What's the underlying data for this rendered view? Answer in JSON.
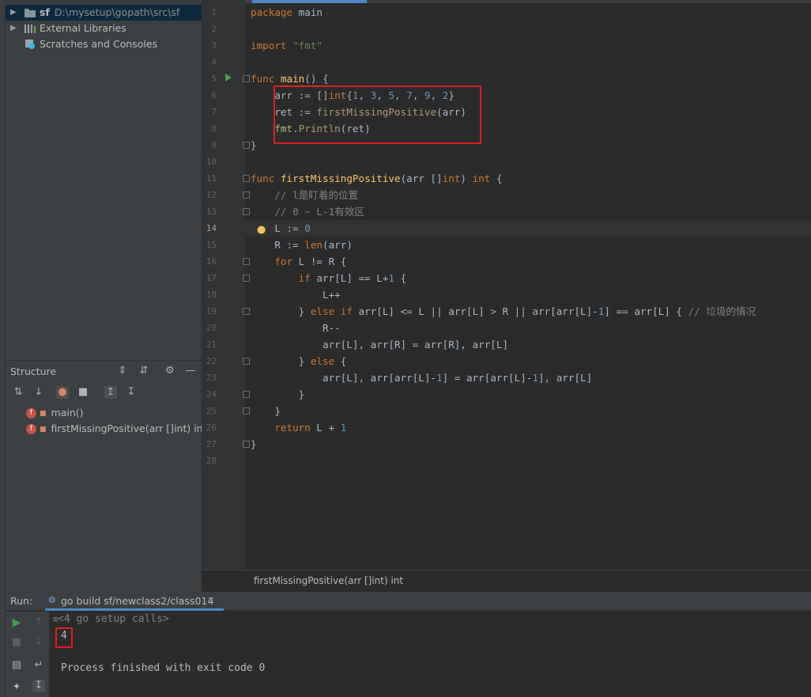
{
  "project": {
    "items": [
      {
        "name": "sf",
        "path": "D:\\mysetup\\gopath\\src\\sf",
        "icon": "folder-icon"
      },
      {
        "name": "External Libraries",
        "icon": "library-icon"
      },
      {
        "name": "Scratches and Consoles",
        "icon": "scratches-icon"
      }
    ]
  },
  "structure": {
    "title": "Structure",
    "items": [
      {
        "label": "main()"
      },
      {
        "label": "firstMissingPositive(arr []int) int"
      }
    ]
  },
  "editor": {
    "line_numbers": [
      "1",
      "2",
      "3",
      "4",
      "5",
      "6",
      "7",
      "8",
      "9",
      "10",
      "11",
      "12",
      "13",
      "14",
      "15",
      "16",
      "17",
      "18",
      "19",
      "20",
      "21",
      "22",
      "23",
      "24",
      "25",
      "26",
      "27",
      "28"
    ],
    "lines": [
      "package main",
      "",
      "import \"fmt\"",
      "",
      "func main() {",
      "    arr := []int{1, 3, 5, 7, 9, 2}",
      "    ret := firstMissingPositive(arr)",
      "    fmt.Println(ret)",
      "}",
      "",
      "func firstMissingPositive(arr []int) int {",
      "    // l是盯着的位置",
      "    // 0 ~ L-1有效区",
      "    L := 0",
      "    R := len(arr)",
      "    for L != R {",
      "        if arr[L] == L+1 {",
      "            L++",
      "        } else if arr[L] <= L || arr[L] > R || arr[arr[L]-1] == arr[L] { // 垃圾的情况",
      "            R--",
      "            arr[L], arr[R] = arr[R], arr[L]",
      "        } else {",
      "            arr[L], arr[arr[L]-1] = arr[arr[L]-1], arr[L]",
      "        }",
      "    }",
      "    return L + 1",
      "}",
      ""
    ],
    "current_line": 14,
    "breadcrumb": "firstMissingPositive(arr []int) int"
  },
  "run": {
    "label": "Run:",
    "tab_label": "go build sf/newclass2/class014",
    "console": {
      "setup_calls": "<4 go setup calls>",
      "output": "4",
      "exit_message": "Process finished with exit code 0"
    }
  },
  "colors": {
    "highlight_box": "#e02020",
    "keyword": "#cc7832",
    "number": "#6897bb",
    "string": "#6a8759",
    "function": "#ffc66d"
  }
}
